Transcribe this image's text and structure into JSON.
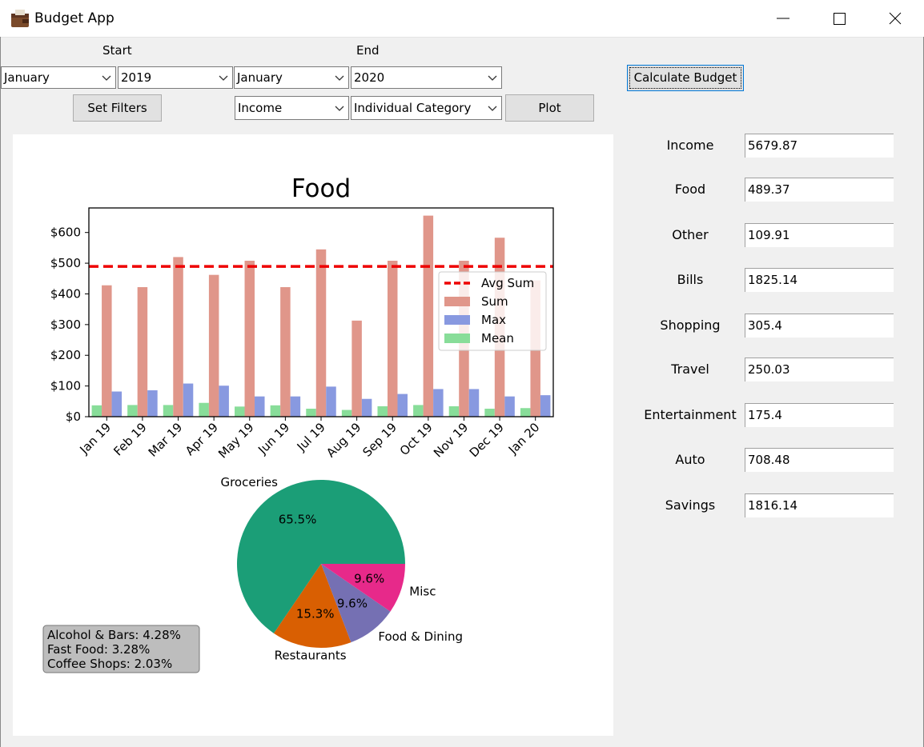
{
  "window": {
    "title": "Budget App",
    "icon": "wallet-icon"
  },
  "filters": {
    "start_label": "Start",
    "end_label": "End",
    "start_month": "January",
    "start_year": "2019",
    "end_month": "January",
    "end_year": "2020",
    "set_filters_label": "Set Filters",
    "type": "Income",
    "mode": "Individual Category",
    "plot_label": "Plot"
  },
  "calculate_label": "Calculate Budget",
  "budget": [
    {
      "label": "Income",
      "value": "5679.87"
    },
    {
      "label": "Food",
      "value": "489.37"
    },
    {
      "label": "Other",
      "value": "109.91"
    },
    {
      "label": "Bills",
      "value": "1825.14"
    },
    {
      "label": "Shopping",
      "value": "305.4"
    },
    {
      "label": "Travel",
      "value": "250.03"
    },
    {
      "label": "Entertainment",
      "value": "175.4"
    },
    {
      "label": "Auto",
      "value": "708.48"
    },
    {
      "label": "Savings",
      "value": "1816.14"
    }
  ],
  "colors": {
    "sum": "#e0968a",
    "max": "#8899e0",
    "mean": "#88dd99",
    "avg": "#ee0000",
    "groceries": "#1b9e77",
    "restaurants": "#d95f02",
    "food_dining": "#7570b3",
    "misc": "#e7298a"
  },
  "chart_data": [
    {
      "type": "bar",
      "title": "Food",
      "categories": [
        "Jan 19",
        "Feb 19",
        "Mar 19",
        "Apr 19",
        "May 19",
        "Jun 19",
        "Jul 19",
        "Aug 19",
        "Sep 19",
        "Oct 19",
        "Nov 19",
        "Dec 19",
        "Jan 20"
      ],
      "series": [
        {
          "name": "Sum",
          "values": [
            428,
            422,
            520,
            462,
            508,
            422,
            545,
            313,
            508,
            655,
            508,
            583,
            444
          ]
        },
        {
          "name": "Max",
          "values": [
            82,
            86,
            108,
            101,
            66,
            66,
            98,
            58,
            74,
            90,
            90,
            66,
            70
          ]
        },
        {
          "name": "Mean",
          "values": [
            37,
            38,
            38,
            45,
            33,
            37,
            26,
            22,
            34,
            38,
            34,
            26,
            28
          ]
        }
      ],
      "reference_line": {
        "name": "Avg Sum",
        "value": 489.37,
        "style": "dashed"
      },
      "ylim": [
        0,
        680
      ],
      "yticks": [
        "$0",
        "$100",
        "$200",
        "$300",
        "$400",
        "$500",
        "$600"
      ],
      "legend": "right",
      "grid": false
    },
    {
      "type": "pie",
      "slices": [
        {
          "label": "Groceries",
          "value": 65.5,
          "text": "65.5%"
        },
        {
          "label": "Restaurants",
          "value": 15.3,
          "text": "15.3%"
        },
        {
          "label": "Food & Dining",
          "value": 9.6,
          "text": "9.6%"
        },
        {
          "label": "Misc",
          "value": 9.6,
          "text": "9.6%"
        }
      ],
      "annotation": [
        "Alcohol & Bars: 4.28%",
        "Fast Food: 3.28%",
        "Coffee Shops: 2.03%"
      ]
    }
  ]
}
